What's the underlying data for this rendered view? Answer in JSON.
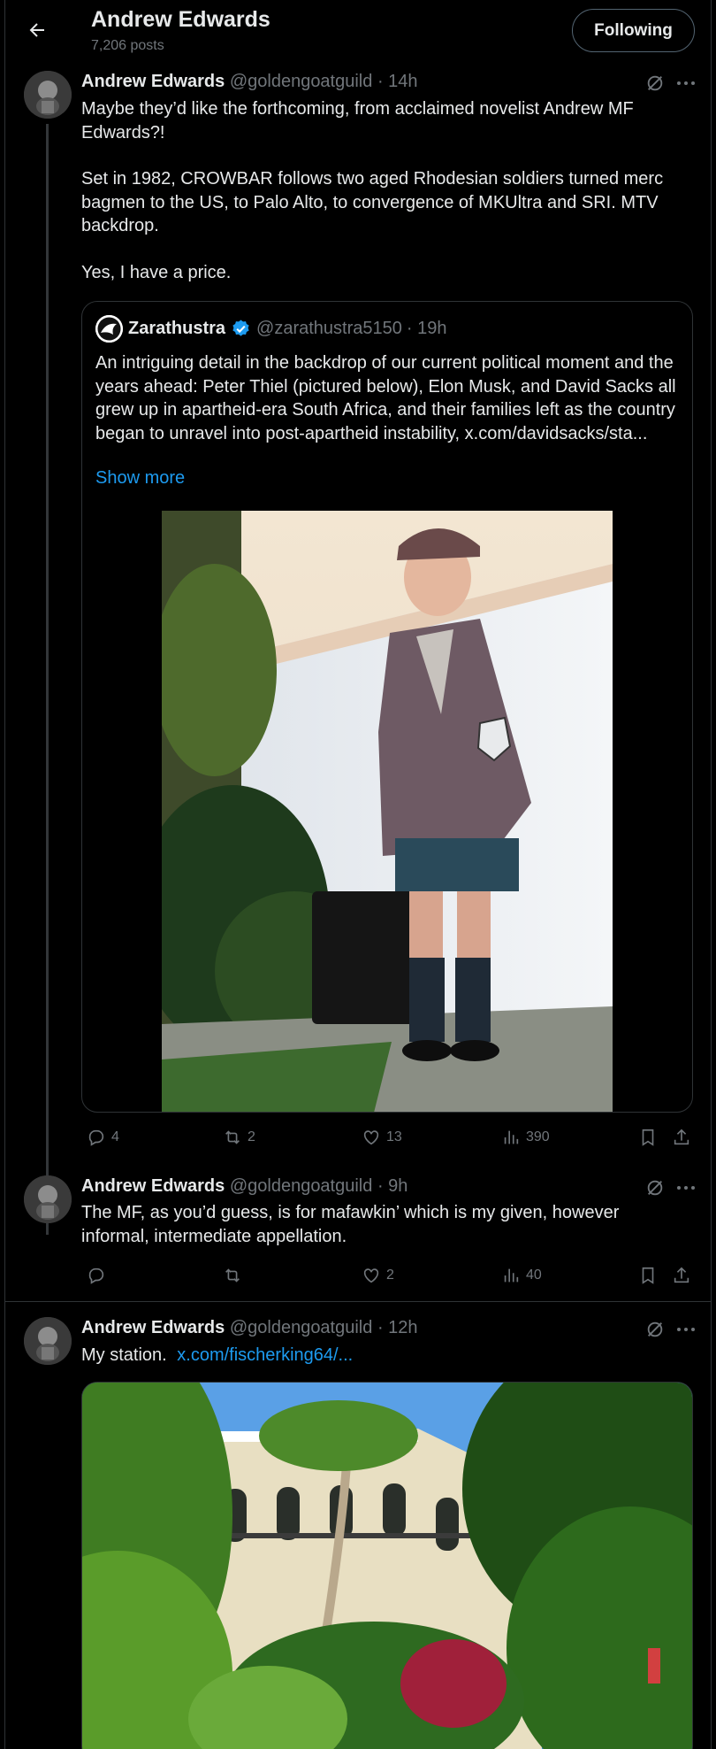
{
  "header": {
    "name": "Andrew Edwards",
    "post_count": "7,206 posts",
    "follow_label": "Following"
  },
  "posts": [
    {
      "name": "Andrew Edwards",
      "handle": "@goldengoatguild",
      "time": "· 14h",
      "paragraphs": [
        "Maybe they’d like the forthcoming, from acclaimed novelist Andrew MF Edwards?!",
        "Set in 1982, CROWBAR follows two aged Rhodesian soldiers turned merc bagmen to the US, to Palo Alto, to convergence of MKUltra and SRI. MTV backdrop.",
        "Yes, I have a price."
      ],
      "quote": {
        "name": "Zarathustra",
        "handle": "@zarathustra5150",
        "time": "· 19h",
        "text": "An intriguing detail in the backdrop of our current political moment and the years ahead: Peter Thiel (pictured below), Elon Musk, and David Sacks all grew up in apartheid-era South Africa, and their families left as the country began to unravel into post-apartheid instability, x.com/davidsacks/sta...",
        "show_more": "Show more"
      },
      "stats": {
        "replies": "4",
        "reposts": "2",
        "likes": "13",
        "views": "390"
      }
    },
    {
      "name": "Andrew Edwards",
      "handle": "@goldengoatguild",
      "time": "· 9h",
      "text": "The MF, as you’d guess, is for mafawkin’ which is my given, however informal, intermediate appellation.",
      "stats": {
        "replies": "",
        "reposts": "",
        "likes": "2",
        "views": "40"
      }
    },
    {
      "name": "Andrew Edwards",
      "handle": "@goldengoatguild",
      "time": "· 12h",
      "text": "My station.",
      "link": "x.com/fischerking64/..."
    }
  ],
  "icons": {
    "back": "arrow-left-icon",
    "grok": "grok-icon",
    "more": "more-horizontal-icon",
    "reply": "reply-icon",
    "repost": "repost-icon",
    "like": "heart-icon",
    "views": "views-icon",
    "bookmark": "bookmark-icon",
    "share": "share-icon",
    "verified": "verified-badge-icon"
  },
  "colors": {
    "background": "#000000",
    "text": "#e7e9ea",
    "muted": "#71767b",
    "link": "#1d9bf0",
    "border": "#2f3336"
  }
}
